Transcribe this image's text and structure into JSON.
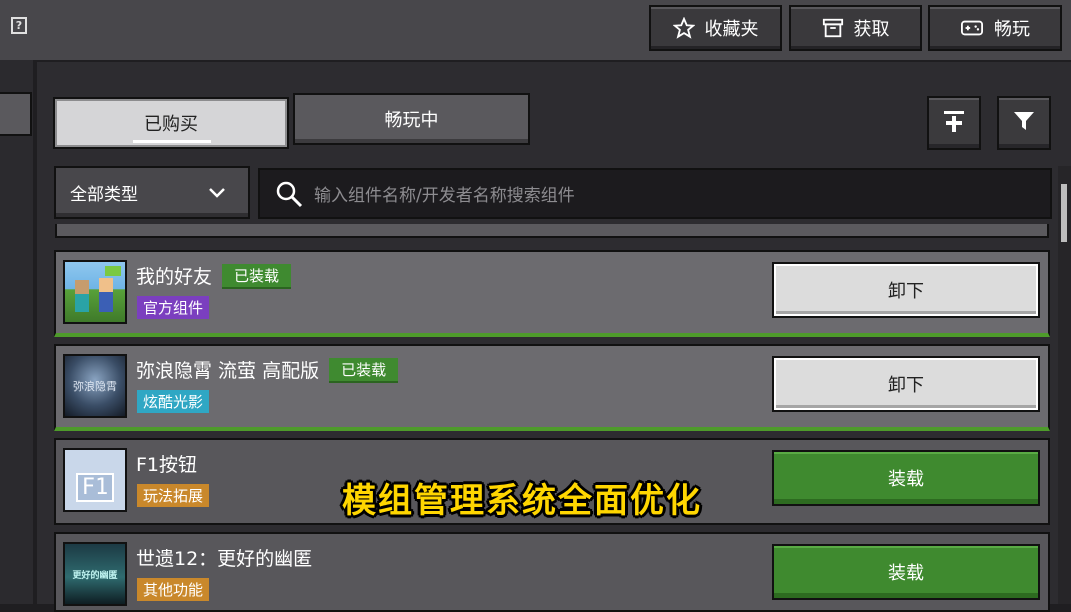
{
  "topbar": {
    "help_icon": "question-icon",
    "buttons": [
      {
        "label": "收藏夹",
        "icon": "star-icon"
      },
      {
        "label": "获取",
        "icon": "store-icon"
      },
      {
        "label": "畅玩",
        "icon": "gamepad-icon"
      }
    ]
  },
  "tabs": [
    {
      "label": "已购买",
      "active": true
    },
    {
      "label": "畅玩中",
      "active": false
    }
  ],
  "toolbar": {
    "pin_icon": "pin-to-top-icon",
    "filter_icon": "filter-icon"
  },
  "filter": {
    "category": "全部类型"
  },
  "search": {
    "placeholder": "输入组件名称/开发者名称搜索组件"
  },
  "items": [
    {
      "name": "我的好友",
      "status": "已装载",
      "tag": "官方组件",
      "tag_color": "#7b3fbf",
      "action": "卸下",
      "installed": true
    },
    {
      "name": "弥浪隐霄 流萤 高配版",
      "status": "已装载",
      "tag": "炫酷光影",
      "tag_color": "#2fa7c4",
      "action": "卸下",
      "installed": true,
      "thumb_text": "弥浪隐霄"
    },
    {
      "name": "F1按钮",
      "status": "",
      "tag": "玩法拓展",
      "tag_color": "#c9882b",
      "action": "装载",
      "installed": false,
      "thumb_text": "F1"
    },
    {
      "name": "世遗12：更好的幽匿",
      "status": "",
      "tag": "其他功能",
      "tag_color": "#c9882b",
      "action": "装载",
      "installed": false,
      "thumb_text": "更好的幽匿"
    }
  ],
  "caption": "模组管理系统全面优化",
  "colors": {
    "installed_green": "#4e9b2b",
    "install_button": "#3f8a2f",
    "caption_yellow": "#ffd600"
  }
}
